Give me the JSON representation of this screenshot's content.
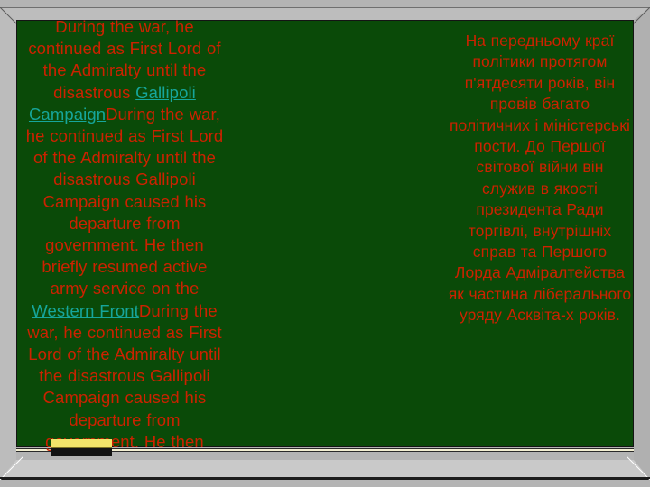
{
  "slide": {
    "background_color": "#b4b4b4",
    "panel_color": "#0a4a08",
    "text_color": "#cc2200",
    "link_color": "#16a69b",
    "marker_color": "#f2e46a"
  },
  "left_column": {
    "lines": [
      {
        "text": "During the war, he continued as First Lord of the Admiralty until the disastrous ",
        "kind": "text"
      },
      {
        "text": "Gallipoli Campaign",
        "kind": "link"
      },
      {
        "text": "During the war, he continued as First Lord of the Admiralty until the disastrous Gallipoli Campaign caused his departure from government. He then briefly resumed active army service on the ",
        "kind": "text"
      },
      {
        "text": "Western Front",
        "kind": "link"
      },
      {
        "text": "During the war, he continued as First Lord of the Admiralty until the disastrous Gallipoli Campaign caused his departure from government. He then",
        "kind": "text"
      }
    ],
    "full_text": "During the war, he continued as First Lord of the Admiralty until the disastrous Gallipoli CampaignDuring the war, he continued as First Lord of the Admiralty until the disastrous Gallipoli Campaign caused his departure from government. He then briefly resumed active army service on the Western FrontDuring the war, he continued as First Lord of the Admiralty until the disastrous Gallipoli Campaign caused his departure from government. He then"
  },
  "right_column": {
    "text": "На передньому краї політики протягом п'ятдесяти років, він провів багато політичних і міністерські пости. До Першої світової війни він служив в якості президента Ради торгівлі, внутрішніх справ та Першого Лорда Адміралтейства як частина ліберального уряду Асквіта-х років."
  },
  "links": {
    "gallipoli": "Gallipoli Campaign",
    "western_front": "Western Front"
  }
}
